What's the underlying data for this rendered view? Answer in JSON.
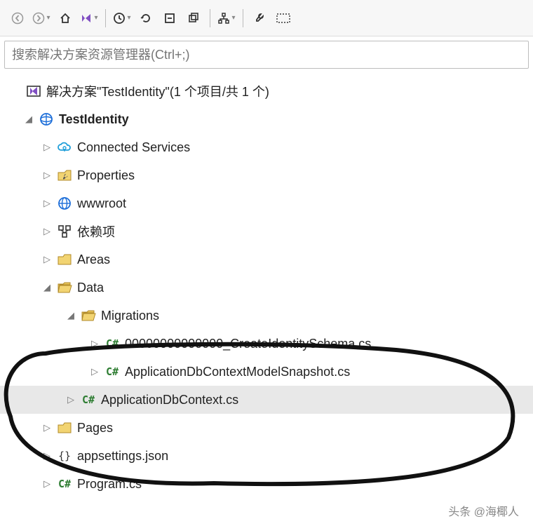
{
  "search": {
    "placeholder": "搜索解决方案资源管理器(Ctrl+;)"
  },
  "solution": {
    "label": "解决方案\"TestIdentity\"(1 个项目/共 1 个)",
    "project": "TestIdentity"
  },
  "nodes": {
    "connected_services": "Connected Services",
    "properties": "Properties",
    "wwwroot": "wwwroot",
    "dependencies": "依赖项",
    "areas": "Areas",
    "data": "Data",
    "migrations": "Migrations",
    "mig_file1": "00000000000000_CreateIdentitySchema.cs",
    "mig_file2": "ApplicationDbContextModelSnapshot.cs",
    "dbcontext": "ApplicationDbContext.cs",
    "pages": "Pages",
    "appsettings": "appsettings.json",
    "program": "Program.cs"
  },
  "watermark": "头条 @海椰人"
}
